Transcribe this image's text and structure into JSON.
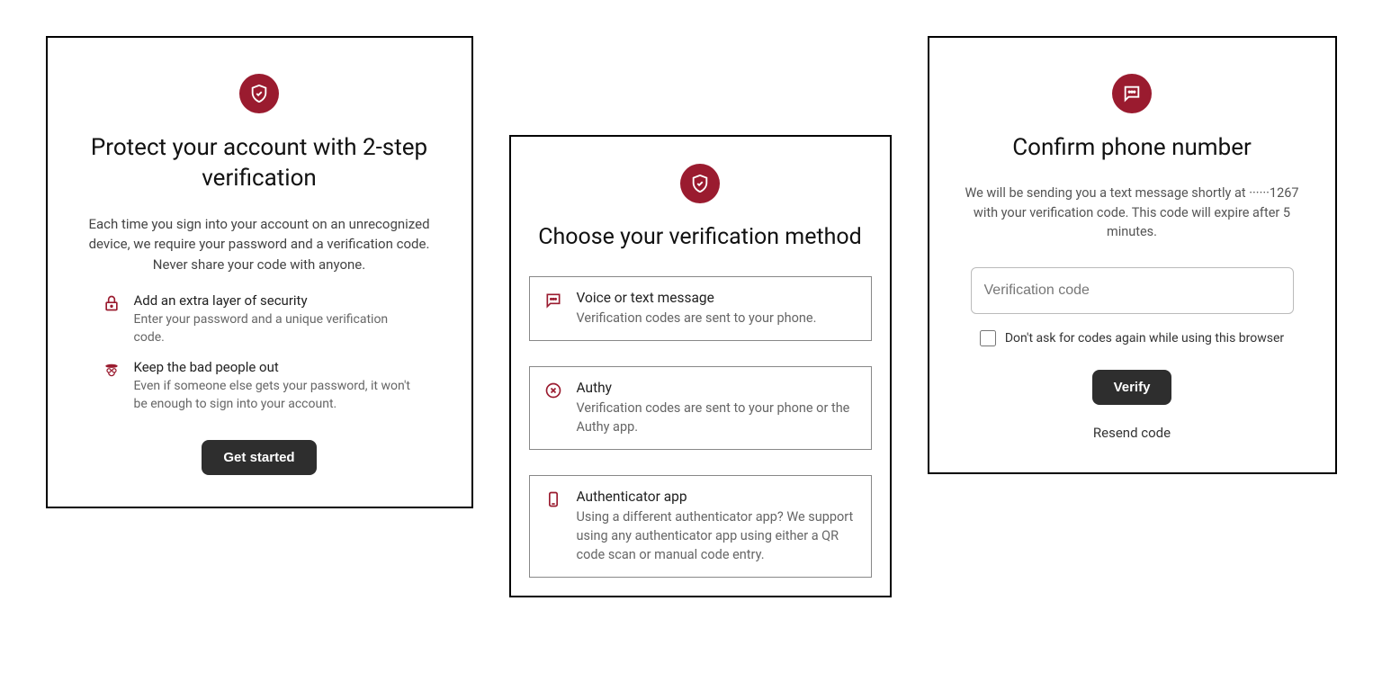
{
  "colors": {
    "accent": "#9a1b2f"
  },
  "panel1": {
    "title": "Protect your account with 2-step verification",
    "description": "Each time you sign into your account on an unrecognized device, we require your password and a verification code. Never share your code with anyone.",
    "features": [
      {
        "title": "Add an extra layer of security",
        "subtitle": "Enter your password and a unique verification code."
      },
      {
        "title": "Keep the bad people out",
        "subtitle": "Even if someone else gets your password, it won't be enough to sign into your account."
      }
    ],
    "cta": "Get started"
  },
  "panel2": {
    "title": "Choose your verification method",
    "methods": [
      {
        "title": "Voice or text message",
        "subtitle": "Verification codes are sent to your phone."
      },
      {
        "title": "Authy",
        "subtitle": "Verification codes are sent to your phone or the Authy app."
      },
      {
        "title": "Authenticator app",
        "subtitle": "Using a different authenticator app? We support using any authenticator app using either a QR code scan or manual code entry."
      }
    ]
  },
  "panel3": {
    "title": "Confirm phone number",
    "description": "We will be sending you a text message shortly at ······1267 with your verification code. This code will expire after 5 minutes.",
    "placeholder": "Verification code",
    "checkbox_label": "Don't ask for codes again while using this browser",
    "verify": "Verify",
    "resend": "Resend code"
  }
}
